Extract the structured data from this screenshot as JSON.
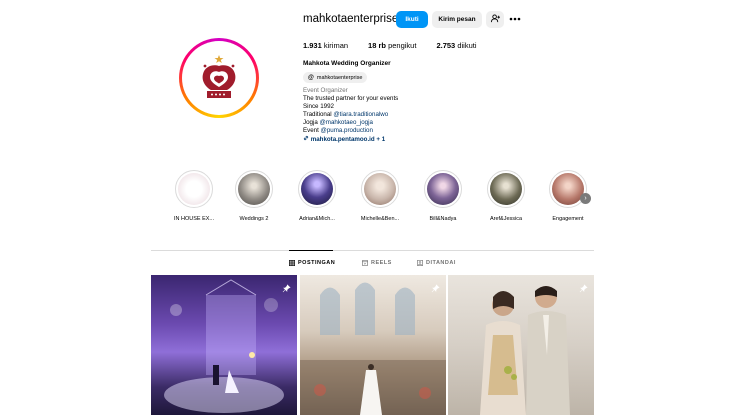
{
  "profile": {
    "username": "mahkotaenterprise",
    "follow_label": "Ikuti",
    "message_label": "Kirim pesan",
    "stats": {
      "posts_value": "1.931",
      "posts_label": "kiriman",
      "followers_value": "18 rb",
      "followers_label": "pengikut",
      "following_value": "2.753",
      "following_label": "diikuti"
    },
    "full_name": "Mahkota Wedding Organizer",
    "threads_handle": "mahkotaenterprise",
    "category": "Event Organizer",
    "bio_lines": [
      "The trusted partner for your events",
      "Since 1992"
    ],
    "bio_traditional_prefix": "Traditional ",
    "bio_traditional_mention": "@tiara.traditionalwo",
    "bio_jogja_prefix": "Jogja ",
    "bio_jogja_mention": "@mahkotaeo_jogja",
    "bio_event_prefix": "Event ",
    "bio_event_mention": "@puma.production",
    "link_text": "mahkota.pentamoo.id + 1"
  },
  "highlights": [
    {
      "label": "IN HOUSE EX...",
      "color": "#f3e9ec"
    },
    {
      "label": "Weddings 2",
      "color": "#8f8a84"
    },
    {
      "label": "Adrian&Mich...",
      "color": "#2b2a55"
    },
    {
      "label": "Michelle&Ben...",
      "color": "#c9b6ab"
    },
    {
      "label": "Bill&Nadya",
      "color": "#5b4a72"
    },
    {
      "label": "Aref&Jessica",
      "color": "#6d6a55"
    },
    {
      "label": "Engagement",
      "color": "#b6786a"
    }
  ],
  "tabs": [
    {
      "label": "POSTINGAN",
      "icon": "grid-icon"
    },
    {
      "label": "REELS",
      "icon": "reels-icon"
    },
    {
      "label": "DITANDAI",
      "icon": "tagged-icon"
    }
  ],
  "posts": [
    {
      "theme": "purple-stage",
      "pinned": true
    },
    {
      "theme": "church-aisle",
      "pinned": true
    },
    {
      "theme": "couple-portrait",
      "pinned": true
    }
  ],
  "colors": {
    "follow_button": "#0095f6",
    "logo_red": "#a01c2c",
    "link": "#00376b"
  }
}
